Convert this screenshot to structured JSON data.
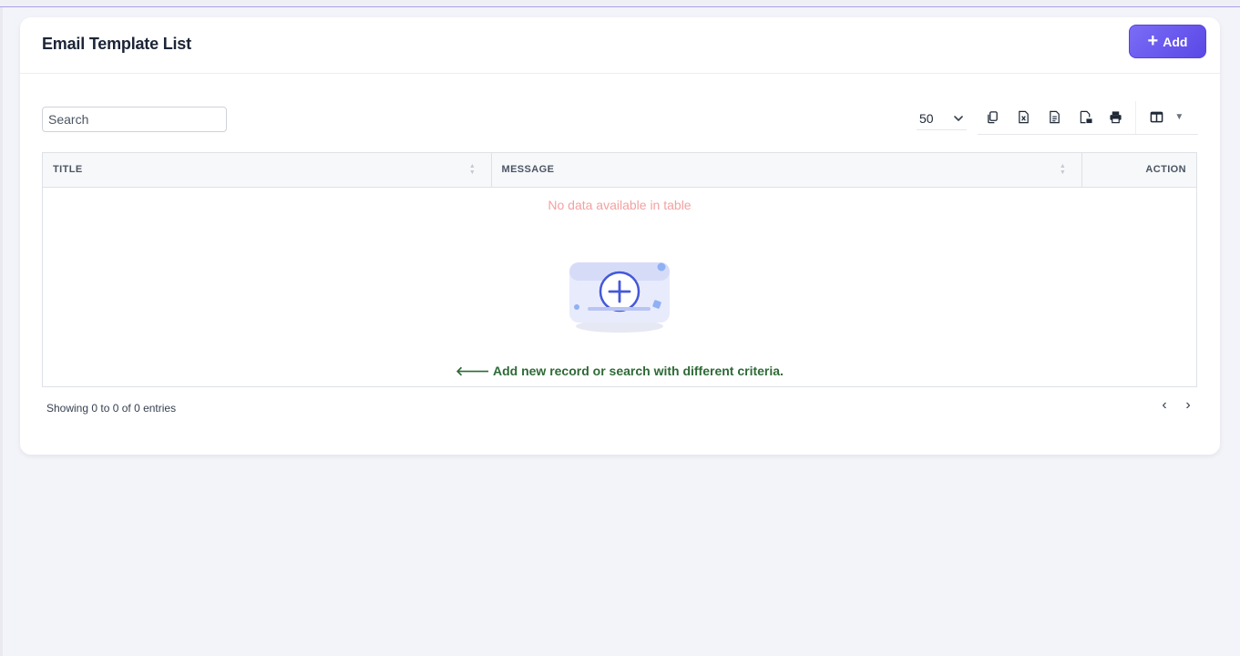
{
  "page": {
    "title": "Email Template List",
    "add_label": "Add"
  },
  "toolbar": {
    "search_placeholder": "Search",
    "page_length": "50",
    "export_buttons": [
      "copy-icon",
      "excel-icon",
      "csv-icon",
      "pdf-icon",
      "print-icon"
    ],
    "column_visibility_icon": "columns-icon"
  },
  "table": {
    "columns": [
      "TITLE",
      "MESSAGE",
      "ACTION"
    ],
    "empty_message": "No data available in table",
    "empty_hint": "Add new record or search with different criteria.",
    "info": "Showing 0 to 0 of 0 entries"
  },
  "colors": {
    "accent": "#6554ee",
    "empty_message": "#f3a1a1",
    "empty_hint": "#2e6a36"
  }
}
